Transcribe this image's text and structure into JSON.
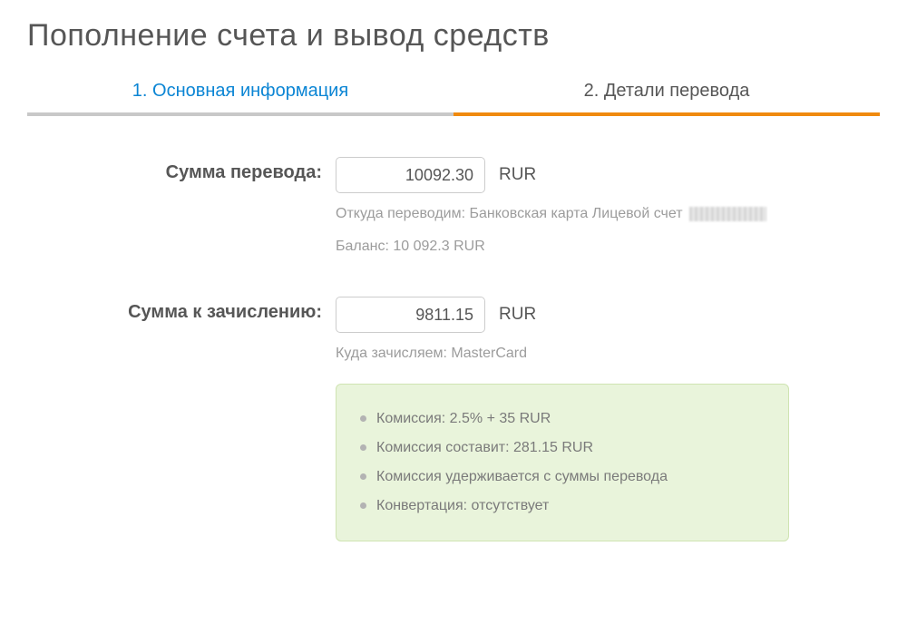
{
  "page_title": "Пополнение счета и вывод средств",
  "tabs": {
    "basic_info": "1. Основная информация",
    "transfer_details": "2. Детали перевода"
  },
  "form": {
    "transfer_amount_label": "Сумма перевода:",
    "transfer_amount_value": "10092.30",
    "transfer_amount_currency": "RUR",
    "source_hint_prefix": "Откуда переводим: Банковская карта Лицевой счет",
    "balance_hint": "Баланс: 10 092.3 RUR",
    "credit_amount_label": "Сумма к зачислению:",
    "credit_amount_value": "9811.15",
    "credit_amount_currency": "RUR",
    "destination_hint": "Куда зачисляем:  MasterCard"
  },
  "info": {
    "commission_rate": "Комиссия: 2.5% + 35 RUR",
    "commission_amount": "Комиссия составит: 281.15 RUR",
    "commission_note": "Комиссия удерживается с суммы перевода",
    "conversion": "Конвертация: отсутствует"
  }
}
